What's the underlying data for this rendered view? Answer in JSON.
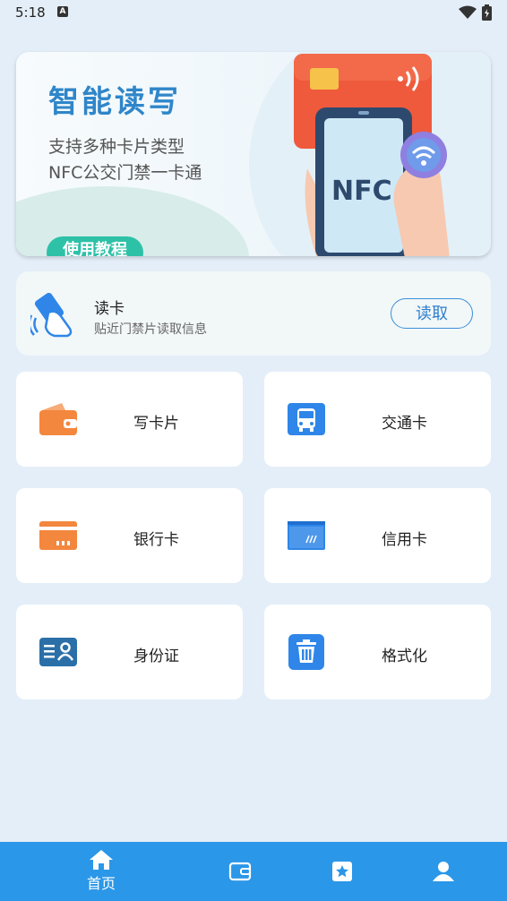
{
  "status": {
    "time": "5:18",
    "badge": "A"
  },
  "banner": {
    "title": "智能读写",
    "subtitle1": "支持多种卡片类型",
    "subtitle2": "NFC公交门禁一卡通",
    "tutorial_label": "使用教程",
    "nfc_text": "NFC"
  },
  "read_card": {
    "title": "读卡",
    "description": "贴近门禁片读取信息",
    "button_label": "读取"
  },
  "tiles": [
    {
      "label": "写卡片",
      "icon": "wallet-icon",
      "color": "#f3873e"
    },
    {
      "label": "交通卡",
      "icon": "bus-icon",
      "color": "#2f86e8"
    },
    {
      "label": "银行卡",
      "icon": "bank-card-icon",
      "color": "#f3873e"
    },
    {
      "label": "信用卡",
      "icon": "credit-card-icon",
      "color": "#2f86e8"
    },
    {
      "label": "身份证",
      "icon": "id-card-icon",
      "color": "#2a6fa8"
    },
    {
      "label": "格式化",
      "icon": "trash-icon",
      "color": "#2f86e8"
    }
  ],
  "nav": [
    {
      "label": "首页",
      "icon": "home-icon",
      "active": true
    },
    {
      "label": "",
      "icon": "wallet-icon"
    },
    {
      "label": "",
      "icon": "star-icon"
    },
    {
      "label": "",
      "icon": "user-icon"
    }
  ],
  "colors": {
    "accent": "#2b97e8",
    "orange": "#f3873e",
    "teal": "#2dc1a8"
  }
}
